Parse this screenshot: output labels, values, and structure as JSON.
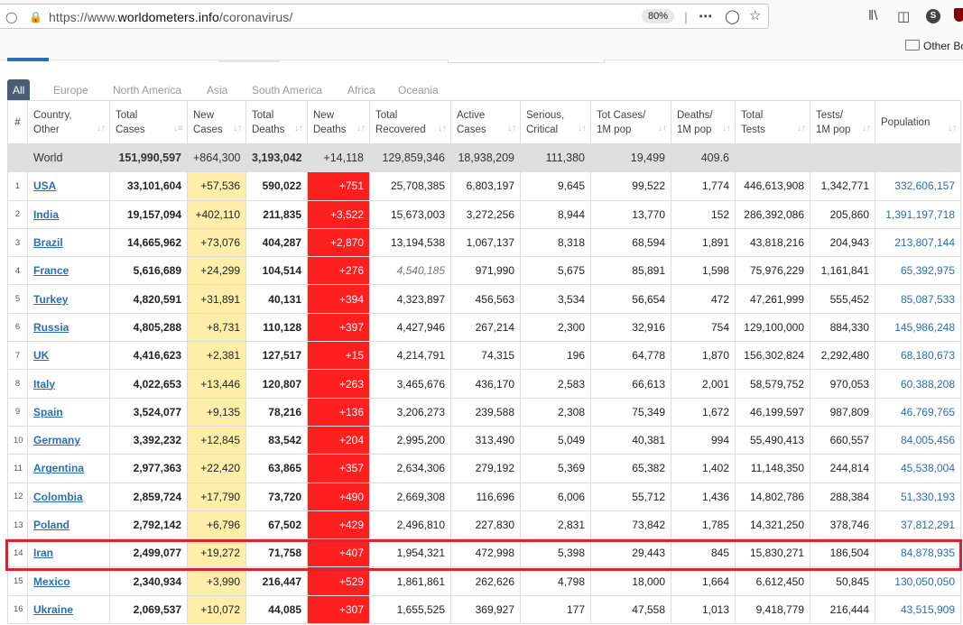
{
  "browser": {
    "url_prefix": "https://www.",
    "url_domain": "worldometers.info",
    "url_path": "/coronavirus/",
    "zoom": "80%",
    "profile_initial": "S",
    "bookmark_folder": "Other Bo"
  },
  "tabs": [
    "All",
    "Europe",
    "North America",
    "Asia",
    "South America",
    "Africa",
    "Oceania"
  ],
  "columns": [
    {
      "line1": "#",
      "line2": ""
    },
    {
      "line1": "Country,",
      "line2": "Other"
    },
    {
      "line1": "Total",
      "line2": "Cases"
    },
    {
      "line1": "New",
      "line2": "Cases"
    },
    {
      "line1": "Total",
      "line2": "Deaths"
    },
    {
      "line1": "New",
      "line2": "Deaths"
    },
    {
      "line1": "Total",
      "line2": "Recovered"
    },
    {
      "line1": "Active",
      "line2": "Cases"
    },
    {
      "line1": "Serious,",
      "line2": "Critical"
    },
    {
      "line1": "Tot Cases/",
      "line2": "1M pop"
    },
    {
      "line1": "Deaths/",
      "line2": "1M pop"
    },
    {
      "line1": "Total",
      "line2": "Tests"
    },
    {
      "line1": "Tests/",
      "line2": "1M pop"
    },
    {
      "line1": "Population",
      "line2": ""
    }
  ],
  "world": [
    "",
    "World",
    "151,990,597",
    "+864,300",
    "3,193,042",
    "+14,118",
    "129,859,346",
    "18,938,209",
    "111,380",
    "19,499",
    "409.6",
    "",
    "",
    ""
  ],
  "rows": [
    [
      "1",
      "USA",
      "33,101,604",
      "+57,536",
      "590,022",
      "+751",
      "25,708,385",
      "6,803,197",
      "9,645",
      "99,522",
      "1,774",
      "446,613,908",
      "1,342,771",
      "332,606,157"
    ],
    [
      "2",
      "India",
      "19,157,094",
      "+402,110",
      "211,835",
      "+3,522",
      "15,673,003",
      "3,272,256",
      "8,944",
      "13,770",
      "152",
      "286,392,086",
      "205,860",
      "1,391,197,718"
    ],
    [
      "3",
      "Brazil",
      "14,665,962",
      "+73,076",
      "404,287",
      "+2,870",
      "13,194,538",
      "1,067,137",
      "8,318",
      "68,594",
      "1,891",
      "43,818,216",
      "204,943",
      "213,807,144"
    ],
    [
      "4",
      "France",
      "5,616,689",
      "+24,299",
      "104,514",
      "+276",
      "4,540,185",
      "971,990",
      "5,675",
      "85,891",
      "1,598",
      "75,976,229",
      "1,161,841",
      "65,392,975"
    ],
    [
      "5",
      "Turkey",
      "4,820,591",
      "+31,891",
      "40,131",
      "+394",
      "4,323,897",
      "456,563",
      "3,534",
      "56,654",
      "472",
      "47,261,999",
      "555,452",
      "85,087,533"
    ],
    [
      "6",
      "Russia",
      "4,805,288",
      "+8,731",
      "110,128",
      "+397",
      "4,427,946",
      "267,214",
      "2,300",
      "32,916",
      "754",
      "129,100,000",
      "884,330",
      "145,986,248"
    ],
    [
      "7",
      "UK",
      "4,416,623",
      "+2,381",
      "127,517",
      "+15",
      "4,214,791",
      "74,315",
      "196",
      "64,778",
      "1,870",
      "156,302,824",
      "2,292,480",
      "68,180,673"
    ],
    [
      "8",
      "Italy",
      "4,022,653",
      "+13,446",
      "120,807",
      "+263",
      "3,465,676",
      "436,170",
      "2,583",
      "66,613",
      "2,001",
      "58,579,752",
      "970,053",
      "60,388,208"
    ],
    [
      "9",
      "Spain",
      "3,524,077",
      "+9,135",
      "78,216",
      "+136",
      "3,206,273",
      "239,588",
      "2,308",
      "75,349",
      "1,672",
      "46,199,597",
      "987,809",
      "46,769,765"
    ],
    [
      "10",
      "Germany",
      "3,392,232",
      "+12,845",
      "83,542",
      "+204",
      "2,995,200",
      "313,490",
      "5,049",
      "40,381",
      "994",
      "55,490,413",
      "660,557",
      "84,005,456"
    ],
    [
      "11",
      "Argentina",
      "2,977,363",
      "+22,420",
      "63,865",
      "+357",
      "2,634,306",
      "279,192",
      "5,369",
      "65,382",
      "1,402",
      "11,148,350",
      "244,814",
      "45,538,004"
    ],
    [
      "12",
      "Colombia",
      "2,859,724",
      "+17,790",
      "73,720",
      "+490",
      "2,669,308",
      "116,696",
      "6,006",
      "55,712",
      "1,436",
      "14,802,786",
      "288,384",
      "51,330,193"
    ],
    [
      "13",
      "Poland",
      "2,792,142",
      "+6,796",
      "67,502",
      "+429",
      "2,496,810",
      "227,830",
      "2,831",
      "73,842",
      "1,785",
      "14,321,250",
      "378,746",
      "37,812,291"
    ],
    [
      "14",
      "Iran",
      "2,499,077",
      "+19,272",
      "71,758",
      "+407",
      "1,954,321",
      "472,998",
      "5,398",
      "29,443",
      "845",
      "15,830,271",
      "186,504",
      "84,878,935"
    ],
    [
      "15",
      "Mexico",
      "2,340,934",
      "+3,990",
      "216,447",
      "+529",
      "1,861,861",
      "262,626",
      "4,798",
      "18,000",
      "1,664",
      "6,612,450",
      "50,845",
      "130,050,050"
    ],
    [
      "16",
      "Ukraine",
      "2,069,537",
      "+10,072",
      "44,085",
      "+307",
      "1,655,525",
      "369,927",
      "177",
      "47,558",
      "1,013",
      "9,418,779",
      "216,444",
      "43,515,909"
    ]
  ],
  "highlighted_country": "Iran",
  "colors": {
    "new_cases_bg": "#ffeeaa",
    "new_deaths_bg": "#ff1f1f",
    "highlight_border": "#d9232d",
    "link": "#2a6eb5"
  }
}
